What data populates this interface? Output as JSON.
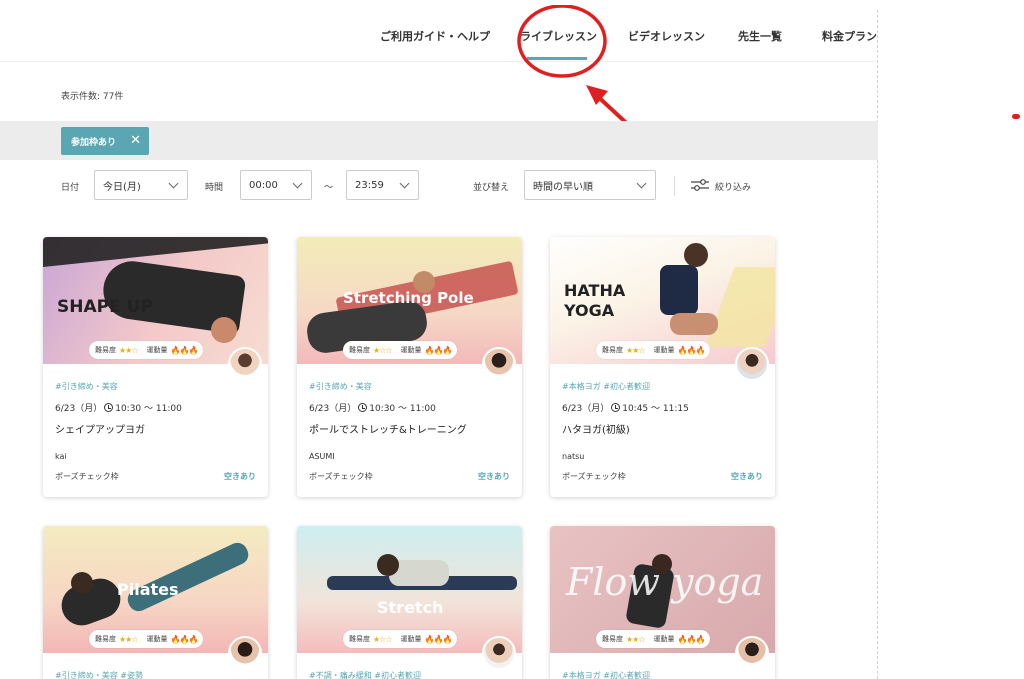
{
  "nav": {
    "items": [
      "ご利用ガイド・ヘルプ",
      "ライブレッスン",
      "ビデオレッスン",
      "先生一覧",
      "料金プラン"
    ],
    "active_index": 1
  },
  "result_count": "表示件数: 77件",
  "filter_chip": {
    "label": "参加枠あり",
    "close": "✕"
  },
  "controls": {
    "date_label": "日付",
    "date_value": "今日(月)",
    "time_label": "時間",
    "time_from": "00:00",
    "tilde": "〜",
    "time_to": "23:59",
    "sort_label": "並び替え",
    "sort_value": "時間の早い順",
    "narrow_label": "絞り込み"
  },
  "card_common": {
    "difficulty_label": "難易度",
    "intensity_label": "運動量"
  },
  "cards": [
    {
      "img_title": "SHAPE UP",
      "difficulty": "★★☆",
      "intensity": "🔥🔥🔥",
      "tags": "#引き締め・美容",
      "date": "6/23（月）",
      "time": "10:30 〜 11:00",
      "name": "シェイプアップヨガ",
      "teacher": "kai",
      "check": "ポーズチェック枠",
      "avail": "空きあり"
    },
    {
      "img_title": "Stretching Pole",
      "difficulty": "★☆☆",
      "intensity": "🔥🔥🔥",
      "tags": "#引き締め・美容",
      "date": "6/23（月）",
      "time": "10:30 〜 11:00",
      "name": "ポールでストレッチ&トレーニング",
      "teacher": "ASUMI",
      "check": "ポーズチェック枠",
      "avail": "空きあり"
    },
    {
      "img_title": "HATHA\nYOGA",
      "difficulty": "★★☆",
      "intensity": "🔥🔥🔥",
      "tags": "#本格ヨガ #初心者歓迎",
      "date": "6/23（月）",
      "time": "10:45 〜 11:15",
      "name": "ハタヨガ(初級)",
      "teacher": "natsu",
      "check": "ポーズチェック枠",
      "avail": "空きあり"
    },
    {
      "img_title": "Pilates",
      "difficulty": "★★☆",
      "intensity": "🔥🔥🔥",
      "tags": "#引き締め・美容 #姿勢"
    },
    {
      "img_title": "Stretch",
      "difficulty": "★☆☆",
      "intensity": "🔥🔥🔥",
      "tags": "#不調・痛み緩和 #初心者歓迎"
    },
    {
      "img_title": "Flow yoga",
      "difficulty": "★★☆",
      "intensity": "🔥🔥🔥",
      "tags": "#本格ヨガ #初心者歓迎"
    }
  ],
  "colors": {
    "accent": "#5aa6b3",
    "annotation_red": "#e02020"
  }
}
